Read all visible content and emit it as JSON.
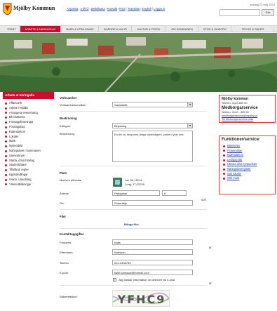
{
  "header": {
    "date": "onsdag 22 maj 2013",
    "brand": "Mjölby Kommun",
    "links": [
      "Anpassa",
      "A till Ö",
      "Webbkarta",
      "Kontakt",
      "RSS",
      "Translate",
      "English",
      "Logga in"
    ],
    "search_button": "Sök"
  },
  "nav": {
    "tabs": [
      "START",
      "ARBETE & NÄRINGSLIV",
      "BARN & UTBILDNING",
      "BOENDE & MILJÖ",
      "KULTUR & FRITID",
      "OM KOMMUNEN",
      "STOD & OMSORG",
      "TRYGG & SÄKER"
    ],
    "active_index": 1
  },
  "sidebar": {
    "title": "Arbete & näringsliv",
    "items": [
      "Affärsverk",
      "Arbete i Mjölby",
      "Arrangera evenemang",
      "Bli skuttarna",
      "Företagsföreningar",
      "Företagslots",
      "Kalendarium",
      "Lokaler",
      "Mark",
      "Nyhetsbild",
      "Näringslivet i kommunen",
      "Samvarman",
      "Starta, driva företag",
      "Studenträtare",
      "Tillstånd, regler",
      "Upphandlingar",
      "Vision, utveckling",
      "Yrkesutbildningar"
    ]
  },
  "form": {
    "sections": {
      "verksamhet": "Verksamhet",
      "beskrivning": "Beskrivning",
      "plats": "Plats",
      "filer": "Filer",
      "kontakt": "Kontaktuppgifter"
    },
    "verksamhetsomrade_label": "Verksamhetsområde:",
    "verksamhetsomrade_value": "Gata/trafik",
    "kategori_label": "Kategori:",
    "kategori_value": "Belysning",
    "beskrivning_label": "Beskrivning:",
    "beskrivning_value": "En del av lamporna längs cykelvägen i parken lyser inte.",
    "markera_label": "Markera på karta:",
    "lat": "Lat: 59,15214",
    "long": "Long: 17,02239",
    "adress_label": "Adress:",
    "adress_value": "Parkgatan",
    "adress_nr": "8",
    "ort_label": "Ort:",
    "ort_value": "Södertälje",
    "bifoga": "Bifoga filer",
    "fornamn_label": "Förnamn:",
    "fornamn_value": "Kalle",
    "efternamn_label": "Efternamn:",
    "efternamn_value": "Karlsson",
    "telefon_label": "Telefon:",
    "telefon_value": "012-3456789",
    "epost_label": "E-post:",
    "epost_value": "kalle.karlsson@hotmail.com",
    "checkbox_label": "Jag önskar information om ärendet via e-post.",
    "sakerhetskod_label": "Säkerhetskod:",
    "captcha_text": "YFHC9"
  },
  "fragments": [
    "och",
    "ar",
    "ar"
  ],
  "right": {
    "contact_title": "Mjölby kommun",
    "contact_phone": "Telefon: 0142-850 00",
    "service_title": "Medborgarservice",
    "service_phone": "Telefon: 0142 - 859 55",
    "service_email": "medborgarservice@mjolby.se",
    "service_link": "Till Medborgarservice sida",
    "functions_title": "Funktioner/service:",
    "functions": [
      "Blanketter",
      "Felanmälan",
      "Kalendarium",
      "Lediga jobb",
      "Lämna dina synpunkter",
      "Näringslivsregister",
      "Sök lokaler",
      "Sök mark"
    ]
  },
  "colors": {
    "accent": "#c8102e",
    "link": "#1f3f9a"
  }
}
